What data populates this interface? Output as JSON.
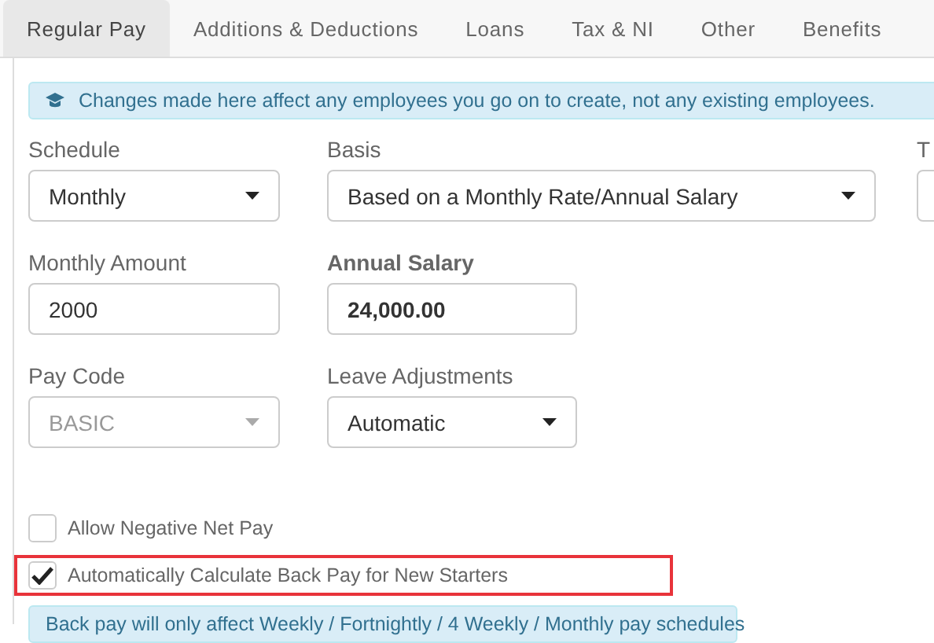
{
  "tabs": [
    {
      "label": "Regular Pay",
      "selected": true
    },
    {
      "label": "Additions & Deductions",
      "selected": false
    },
    {
      "label": "Loans",
      "selected": false
    },
    {
      "label": "Tax & NI",
      "selected": false
    },
    {
      "label": "Other",
      "selected": false
    },
    {
      "label": "Benefits",
      "selected": false
    }
  ],
  "notice": {
    "text": "Changes made here affect any employees you go on to create, not any existing employees."
  },
  "fields": [
    {
      "label": "Schedule",
      "kind": "select",
      "value": "Monthly",
      "disabled": false,
      "bold": false
    },
    {
      "label": "Basis",
      "kind": "select",
      "value": "Based on a Monthly Rate/Annual Salary",
      "disabled": false,
      "bold": false
    },
    {
      "label": "T",
      "kind": "cut"
    },
    {
      "label": "Monthly Amount",
      "kind": "input",
      "value": "2000",
      "disabled": false,
      "bold": false
    },
    {
      "label": "Annual Salary",
      "kind": "input",
      "value": "24,000.00",
      "disabled": false,
      "bold": true
    },
    {
      "label": "Pay Code",
      "kind": "select",
      "value": "BASIC",
      "disabled": true,
      "bold": false
    },
    {
      "label": "Leave Adjustments",
      "kind": "select",
      "value": "Automatic",
      "disabled": false,
      "bold": false
    }
  ],
  "checkboxes": [
    {
      "label": "Allow Negative Net Pay",
      "checked": false,
      "highlighted": false
    },
    {
      "label": "Automatically Calculate Back Pay for New Starters",
      "checked": true,
      "highlighted": true
    }
  ],
  "footnote": {
    "text": "Back pay will only affect Weekly / Fortnightly / 4 Weekly / Monthly pay schedules"
  }
}
